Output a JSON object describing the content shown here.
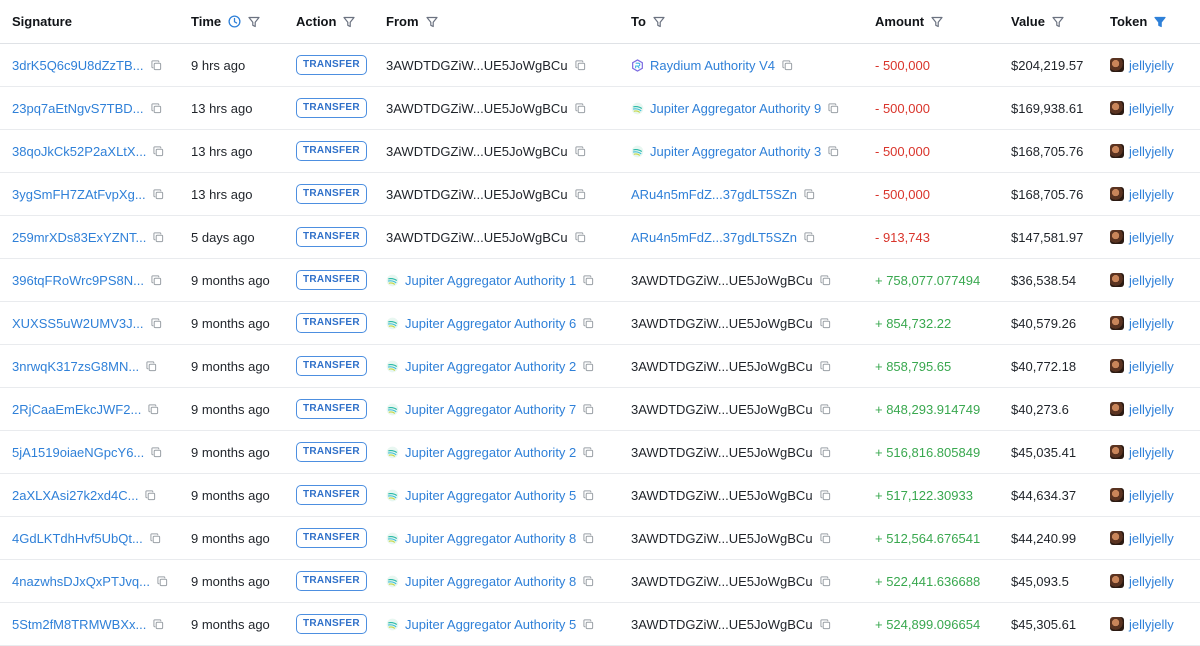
{
  "headers": {
    "signature": "Signature",
    "time": "Time",
    "action": "Action",
    "from": "From",
    "to": "To",
    "amount": "Amount",
    "value": "Value",
    "token": "Token"
  },
  "icons": {
    "clock": "clock-icon",
    "filter": "filter-icon",
    "filter_active": "filter-active-icon",
    "copy": "copy-icon",
    "raydium": "raydium-icon",
    "jupiter": "jupiter-icon",
    "token": "jellyjelly-token-avatar"
  },
  "colors": {
    "link": "#2f80d8",
    "negative": "#d9342b",
    "positive": "#39a84f",
    "badge": "#2f70c9",
    "filter_active": "#2f80d8"
  },
  "rows": [
    {
      "sig": "3drK5Q6c9U8dZzTB...",
      "time": "9 hrs ago",
      "action": "TRANSFER",
      "from": "3AWDTDGZiW...UE5JoWgBCu",
      "from_kind": "address",
      "to": "Raydium Authority V4",
      "to_kind": "raydium",
      "amount": "- 500,000",
      "amount_sign": "neg",
      "value": "$204,219.57",
      "token": "jellyjelly"
    },
    {
      "sig": "23pq7aEtNgvS7TBD...",
      "time": "13 hrs ago",
      "action": "TRANSFER",
      "from": "3AWDTDGZiW...UE5JoWgBCu",
      "from_kind": "address",
      "to": "Jupiter Aggregator Authority 9",
      "to_kind": "jupiter",
      "amount": "- 500,000",
      "amount_sign": "neg",
      "value": "$169,938.61",
      "token": "jellyjelly"
    },
    {
      "sig": "38qoJkCk52P2aXLtX...",
      "time": "13 hrs ago",
      "action": "TRANSFER",
      "from": "3AWDTDGZiW...UE5JoWgBCu",
      "from_kind": "address",
      "to": "Jupiter Aggregator Authority 3",
      "to_kind": "jupiter",
      "amount": "- 500,000",
      "amount_sign": "neg",
      "value": "$168,705.76",
      "token": "jellyjelly"
    },
    {
      "sig": "3ygSmFH7ZAtFvpXg...",
      "time": "13 hrs ago",
      "action": "TRANSFER",
      "from": "3AWDTDGZiW...UE5JoWgBCu",
      "from_kind": "address",
      "to": "ARu4n5mFdZ...37gdLT5SZn",
      "to_kind": "linkaddr",
      "amount": "- 500,000",
      "amount_sign": "neg",
      "value": "$168,705.76",
      "token": "jellyjelly"
    },
    {
      "sig": "259mrXDs83ExYZNT...",
      "time": "5 days ago",
      "action": "TRANSFER",
      "from": "3AWDTDGZiW...UE5JoWgBCu",
      "from_kind": "address",
      "to": "ARu4n5mFdZ...37gdLT5SZn",
      "to_kind": "linkaddr",
      "amount": "- 913,743",
      "amount_sign": "neg",
      "value": "$147,581.97",
      "token": "jellyjelly"
    },
    {
      "sig": "396tqFRoWrc9PS8N...",
      "time": "9 months ago",
      "action": "TRANSFER",
      "from": "Jupiter Aggregator Authority 1",
      "from_kind": "jupiter",
      "to": "3AWDTDGZiW...UE5JoWgBCu",
      "to_kind": "address",
      "amount": "+ 758,077.077494",
      "amount_sign": "pos",
      "value": "$36,538.54",
      "token": "jellyjelly"
    },
    {
      "sig": "XUXSS5uW2UMV3J...",
      "time": "9 months ago",
      "action": "TRANSFER",
      "from": "Jupiter Aggregator Authority 6",
      "from_kind": "jupiter",
      "to": "3AWDTDGZiW...UE5JoWgBCu",
      "to_kind": "address",
      "amount": "+ 854,732.22",
      "amount_sign": "pos",
      "value": "$40,579.26",
      "token": "jellyjelly"
    },
    {
      "sig": "3nrwqK317zsG8MN...",
      "time": "9 months ago",
      "action": "TRANSFER",
      "from": "Jupiter Aggregator Authority 2",
      "from_kind": "jupiter",
      "to": "3AWDTDGZiW...UE5JoWgBCu",
      "to_kind": "address",
      "amount": "+ 858,795.65",
      "amount_sign": "pos",
      "value": "$40,772.18",
      "token": "jellyjelly"
    },
    {
      "sig": "2RjCaaEmEkcJWF2...",
      "time": "9 months ago",
      "action": "TRANSFER",
      "from": "Jupiter Aggregator Authority 7",
      "from_kind": "jupiter",
      "to": "3AWDTDGZiW...UE5JoWgBCu",
      "to_kind": "address",
      "amount": "+ 848,293.914749",
      "amount_sign": "pos",
      "value": "$40,273.6",
      "token": "jellyjelly"
    },
    {
      "sig": "5jA1519oiaeNGpcY6...",
      "time": "9 months ago",
      "action": "TRANSFER",
      "from": "Jupiter Aggregator Authority 2",
      "from_kind": "jupiter",
      "to": "3AWDTDGZiW...UE5JoWgBCu",
      "to_kind": "address",
      "amount": "+ 516,816.805849",
      "amount_sign": "pos",
      "value": "$45,035.41",
      "token": "jellyjelly"
    },
    {
      "sig": "2aXLXAsi27k2xd4C...",
      "time": "9 months ago",
      "action": "TRANSFER",
      "from": "Jupiter Aggregator Authority 5",
      "from_kind": "jupiter",
      "to": "3AWDTDGZiW...UE5JoWgBCu",
      "to_kind": "address",
      "amount": "+ 517,122.30933",
      "amount_sign": "pos",
      "value": "$44,634.37",
      "token": "jellyjelly"
    },
    {
      "sig": "4GdLKTdhHvf5UbQt...",
      "time": "9 months ago",
      "action": "TRANSFER",
      "from": "Jupiter Aggregator Authority 8",
      "from_kind": "jupiter",
      "to": "3AWDTDGZiW...UE5JoWgBCu",
      "to_kind": "address",
      "amount": "+ 512,564.676541",
      "amount_sign": "pos",
      "value": "$44,240.99",
      "token": "jellyjelly"
    },
    {
      "sig": "4nazwhsDJxQxPTJvq...",
      "time": "9 months ago",
      "action": "TRANSFER",
      "from": "Jupiter Aggregator Authority 8",
      "from_kind": "jupiter",
      "to": "3AWDTDGZiW...UE5JoWgBCu",
      "to_kind": "address",
      "amount": "+ 522,441.636688",
      "amount_sign": "pos",
      "value": "$45,093.5",
      "token": "jellyjelly"
    },
    {
      "sig": "5Stm2fM8TRMWBXx...",
      "time": "9 months ago",
      "action": "TRANSFER",
      "from": "Jupiter Aggregator Authority 5",
      "from_kind": "jupiter",
      "to": "3AWDTDGZiW...UE5JoWgBCu",
      "to_kind": "address",
      "amount": "+ 524,899.096654",
      "amount_sign": "pos",
      "value": "$45,305.61",
      "token": "jellyjelly"
    }
  ]
}
